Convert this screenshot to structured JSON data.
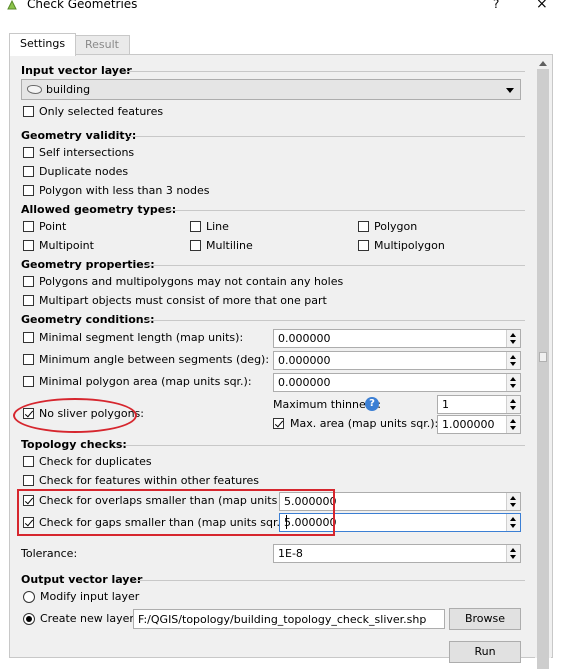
{
  "window": {
    "title": "Check Geometries",
    "help_glyph": "?",
    "close_glyph": "×",
    "app_icon": "qgis-logo-icon"
  },
  "tabs": [
    {
      "label": "Settings",
      "active": true
    },
    {
      "label": "Result",
      "active": false
    }
  ],
  "input_layer": {
    "title": "Input vector layer",
    "layer_value": "building",
    "layer_icon": "polygon-layer-icon",
    "only_selected": {
      "label": "Only selected features",
      "checked": false
    }
  },
  "validity": {
    "title": "Geometry validity:",
    "items": [
      {
        "label": "Self intersections",
        "checked": false
      },
      {
        "label": "Duplicate nodes",
        "checked": false
      },
      {
        "label": "Polygon with less than 3 nodes",
        "checked": false
      }
    ]
  },
  "types": {
    "title": "Allowed geometry types:",
    "items": [
      {
        "label": "Point",
        "checked": false
      },
      {
        "label": "Line",
        "checked": false
      },
      {
        "label": "Polygon",
        "checked": false
      },
      {
        "label": "Multipoint",
        "checked": false
      },
      {
        "label": "Multiline",
        "checked": false
      },
      {
        "label": "Multipolygon",
        "checked": false
      }
    ]
  },
  "properties": {
    "title": "Geometry properties:",
    "items": [
      {
        "label": "Polygons and multipolygons may not contain any holes",
        "checked": false
      },
      {
        "label": "Multipart objects must consist of more that one part",
        "checked": false
      }
    ]
  },
  "conditions": {
    "title": "Geometry conditions:",
    "min_segment": {
      "label": "Minimal segment length (map units):",
      "value": "0.000000",
      "checked": false
    },
    "min_angle": {
      "label": "Minimum angle between segments (deg):",
      "value": "0.000000",
      "checked": false
    },
    "min_area": {
      "label": "Minimal polygon area (map units sqr.):",
      "value": "0.000000",
      "checked": false
    },
    "sliver": {
      "label": "No sliver polygons:",
      "checked": true
    },
    "max_thinness": {
      "label": "Maximum thinness:",
      "value": "1",
      "help_glyph": "?"
    },
    "max_area": {
      "label": "Max. area (map units sqr.):",
      "value": "1.000000",
      "checked": true
    }
  },
  "topology": {
    "title": "Topology checks:",
    "duplicates": {
      "label": "Check for duplicates",
      "checked": false
    },
    "within": {
      "label": "Check for features within other features",
      "checked": false
    },
    "overlaps": {
      "label": "Check for overlaps smaller than (map units sqr.):",
      "value": "5.000000",
      "checked": true
    },
    "gaps": {
      "label": "Check for gaps smaller than (map units sqr.):",
      "value": "5.000000",
      "checked": true
    }
  },
  "tolerance": {
    "label": "Tolerance:",
    "value": "1E-8"
  },
  "output": {
    "title": "Output vector layer",
    "modify": {
      "label": "Modify input layer",
      "selected": false
    },
    "create": {
      "label": "Create new layer",
      "selected": true
    },
    "path": "F:/QGIS/topology/building_topology_check_sliver.shp",
    "browse_label": "Browse"
  },
  "run_label": "Run",
  "colors": {
    "annotation": "#d6262e",
    "help_icon": "#3b7fd4"
  }
}
